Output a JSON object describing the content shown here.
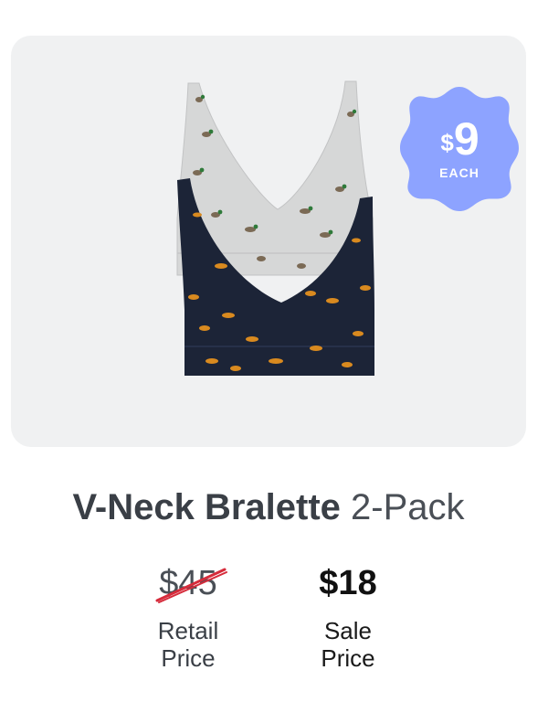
{
  "badge": {
    "currency": "$",
    "amount": "9",
    "label": "EACH",
    "color": "#8da3ff"
  },
  "product": {
    "name": "V-Neck Bralette",
    "pack": "2-Pack",
    "image_alt_items": [
      "duck-print-bralette-gray",
      "fox-print-bralette-navy"
    ]
  },
  "pricing": {
    "retail_value": "$45",
    "retail_label_line1": "Retail",
    "retail_label_line2": "Price",
    "sale_value": "$18",
    "sale_label_line1": "Sale",
    "sale_label_line2": "Price",
    "strike_color": "#d62b3b"
  },
  "colors": {
    "panel_bg": "#f0f1f2",
    "gray_bralette": "#d7d8d8",
    "navy_bralette": "#1d2538",
    "fox_print": "#d98a1f",
    "duck_head": "#2f7a3a"
  }
}
